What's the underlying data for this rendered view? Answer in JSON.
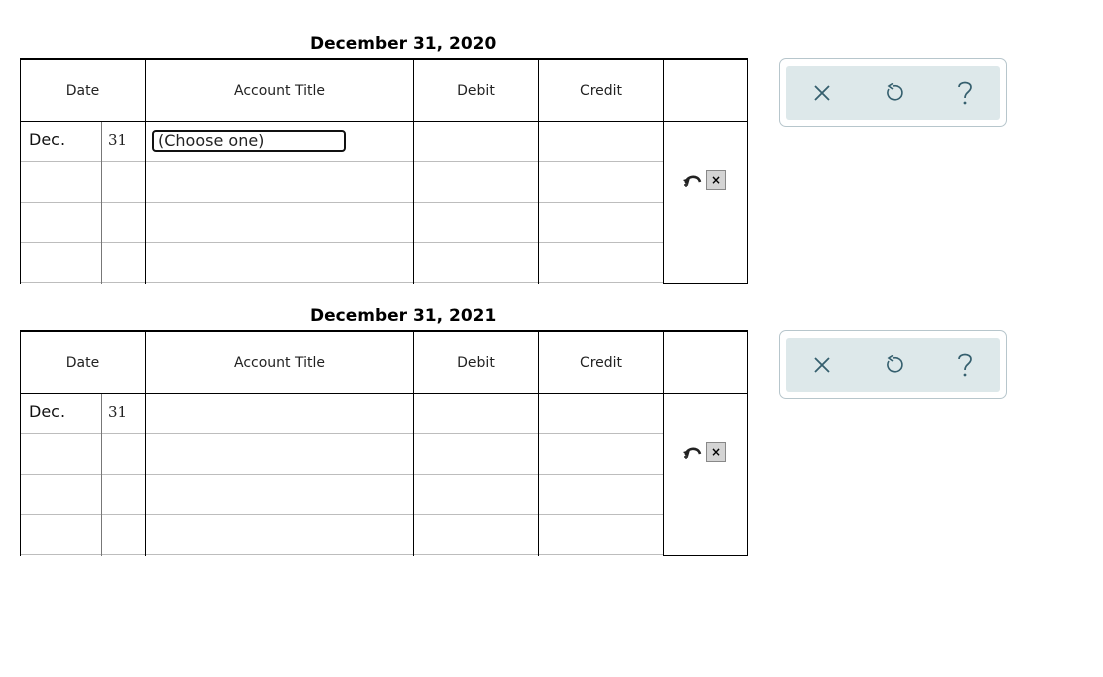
{
  "journals": [
    {
      "title": "December 31, 2020",
      "headers": {
        "date": "Date",
        "account": "Account Title",
        "debit": "Debit",
        "credit": "Credit"
      },
      "rows": [
        {
          "month": "Dec.",
          "day": "31",
          "account": "(Choose one)"
        },
        {
          "month": "",
          "day": "",
          "account": ""
        },
        {
          "month": "",
          "day": "",
          "account": ""
        },
        {
          "month": "",
          "day": "",
          "account": ""
        }
      ]
    },
    {
      "title": "December 31, 2021",
      "headers": {
        "date": "Date",
        "account": "Account Title",
        "debit": "Debit",
        "credit": "Credit"
      },
      "rows": [
        {
          "month": "Dec.",
          "day": "31",
          "account": ""
        },
        {
          "month": "",
          "day": "",
          "account": ""
        },
        {
          "month": "",
          "day": "",
          "account": ""
        },
        {
          "month": "",
          "day": "",
          "account": ""
        }
      ]
    }
  ],
  "row_action_icons": [
    "undo-arrow-icon",
    "delete-x-icon"
  ],
  "row_action_x_label": "×",
  "toolbar_icons": [
    "close-icon",
    "reset-icon",
    "help-icon"
  ],
  "colors": {
    "toolbar_bg": "#dde8ea",
    "toolbar_border": "#b7c6cc",
    "icon_color": "#355f6e"
  }
}
